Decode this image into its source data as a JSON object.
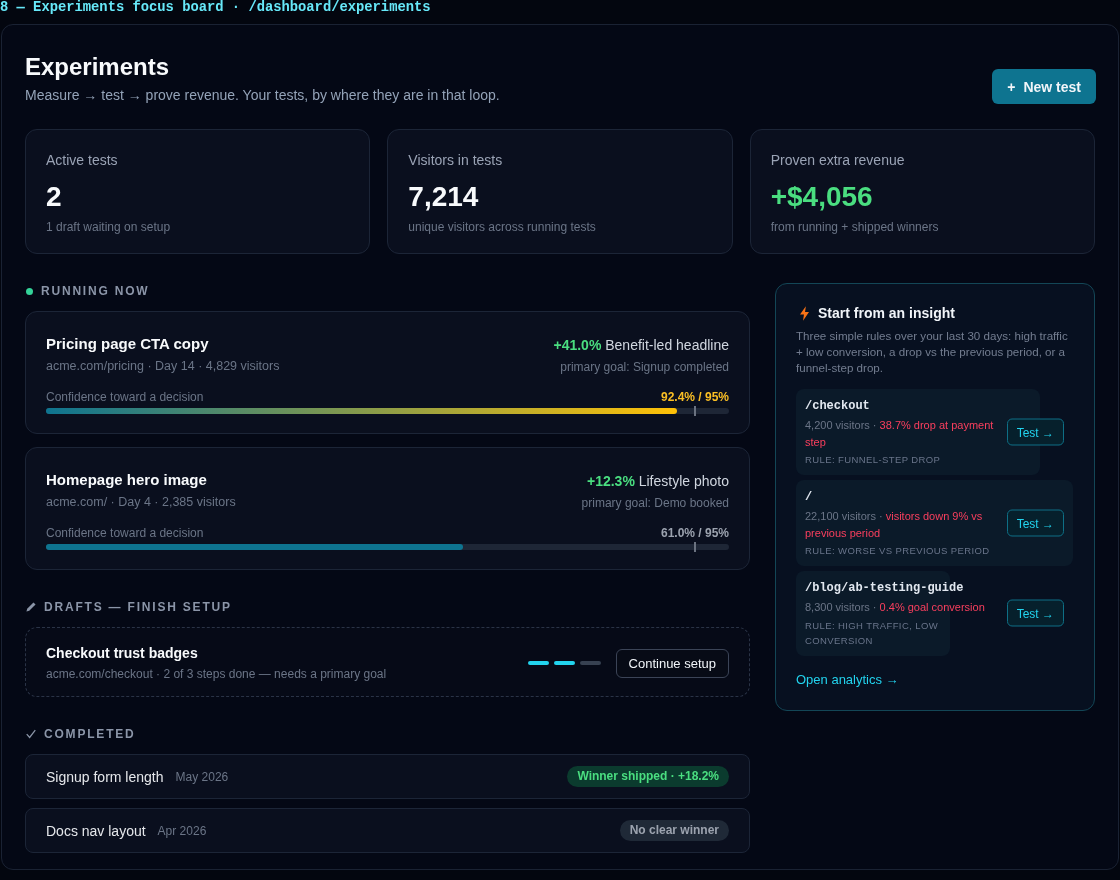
{
  "caption": "8 — Experiments focus board · /dashboard/experiments",
  "header": {
    "title": "Experiments",
    "subtitle": "Measure → test → prove revenue. Your tests, by where they are in that loop.",
    "new_button": {
      "plus": "+",
      "label": "New test"
    }
  },
  "stats": [
    {
      "label": "Active tests",
      "value": "2",
      "note": "1 draft waiting on setup",
      "kind": "plain"
    },
    {
      "label": "Visitors in tests",
      "value": "7,214",
      "note": "unique visitors across running tests",
      "kind": "plain"
    },
    {
      "label": "Proven extra revenue",
      "value": "+$4,056",
      "note": "from running + shipped winners",
      "kind": "positive"
    }
  ],
  "running": {
    "title": "RUNNING NOW",
    "tests": [
      {
        "name": "Pricing page CTA copy",
        "meta": "acme.com/pricing · Day 14 · 4,829 visitors",
        "lift": "+41.0%",
        "variant": "Benefit-led headline",
        "goal": "primary goal: Signup completed",
        "confidence_label": "Confidence toward a decision",
        "reading": "92.4% / 95%",
        "level": 0.924,
        "near_target": true,
        "target": {
          "level": 0.95
        }
      },
      {
        "name": "Homepage hero image",
        "meta": "acme.com/ · Day 4 · 2,385 visitors",
        "lift": "+12.3%",
        "variant": "Lifestyle photo",
        "goal": "primary goal: Demo booked",
        "confidence_label": "Confidence toward a decision",
        "reading": "61.0% / 95%",
        "level": 0.61,
        "near_target": false,
        "target": {
          "level": 0.95
        }
      }
    ]
  },
  "drafts": {
    "title": "DRAFTS — FINISH SETUP",
    "items": [
      {
        "name": "Checkout trust badges",
        "meta": "acme.com/checkout · 2 of 3 steps done — needs a primary goal",
        "steps": [
          {
            "done": true
          },
          {
            "done": true
          },
          {
            "done": false
          }
        ],
        "button": "Continue setup"
      }
    ]
  },
  "completed": {
    "title": "COMPLETED",
    "items": [
      {
        "name": "Signup form length",
        "date": "May 2026",
        "result": "Winner shipped · +18.2%",
        "kind": "winner"
      },
      {
        "name": "Docs nav layout",
        "date": "Apr 2026",
        "result": "No clear winner",
        "kind": "neutral"
      }
    ]
  },
  "insights": {
    "title": "Start from an insight",
    "description": "Three simple rules over your last 30 days: high traffic + low conversion, a drop vs the previous period, or a funnel-step drop.",
    "items": [
      {
        "path": "/checkout",
        "visitors": "4,200 visitors ·",
        "finding": "38.7% drop at payment step",
        "rule": "RULE: FUNNEL-STEP DROP",
        "button": "Test →"
      },
      {
        "path": "/",
        "visitors": "22,100 visitors ·",
        "finding": "visitors down 9% vs previous period",
        "rule": "RULE: WORSE VS PREVIOUS PERIOD",
        "button": "Test →"
      },
      {
        "path": "/blog/ab-testing-guide",
        "visitors": "8,300 visitors ·",
        "finding": "0.4% goal conversion",
        "rule": "RULE: HIGH TRAFFIC, LOW CONVERSION",
        "button": "Test →"
      }
    ],
    "link": "Open analytics →"
  }
}
